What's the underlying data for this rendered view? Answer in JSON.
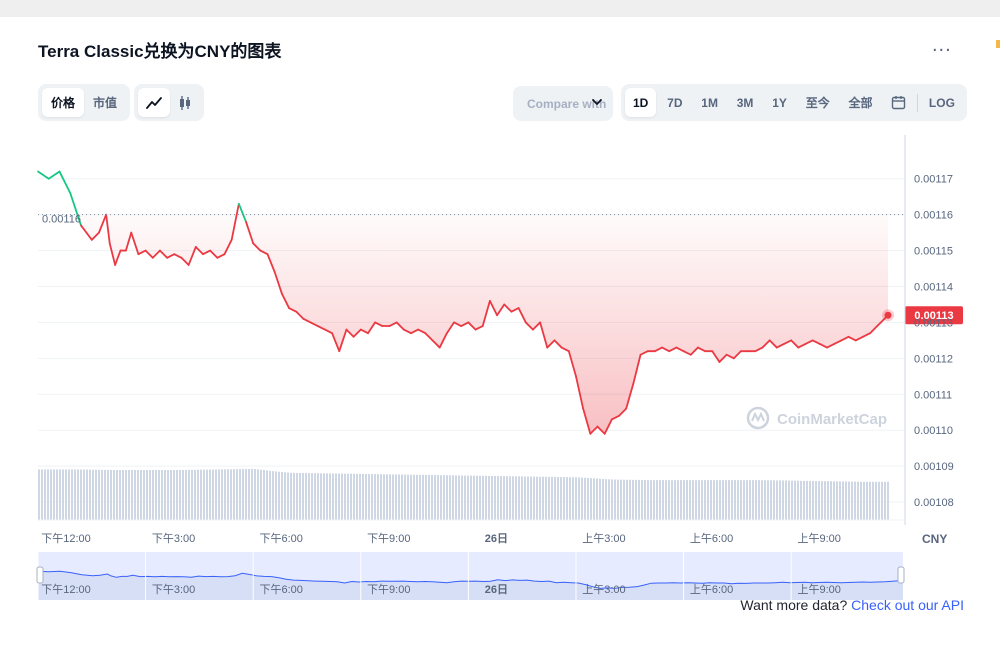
{
  "title": "Terra Classic兑换为CNY的图表",
  "more_label": "...",
  "toggle_metric": [
    {
      "label": "价格",
      "active": true
    },
    {
      "label": "市值",
      "active": false
    }
  ],
  "chart_type_icons": [
    {
      "icon": "line-chart-icon",
      "active": true
    },
    {
      "icon": "candlestick-icon",
      "active": false
    }
  ],
  "compare_label": "Compare with",
  "ranges": [
    {
      "label": "1D",
      "active": true
    },
    {
      "label": "7D",
      "active": false
    },
    {
      "label": "1M",
      "active": false
    },
    {
      "label": "3M",
      "active": false
    },
    {
      "label": "1Y",
      "active": false
    },
    {
      "label": "至今",
      "active": false
    },
    {
      "label": "全部",
      "active": false
    }
  ],
  "calendar_icon": "calendar-icon",
  "log_label": "LOG",
  "watermark": "CoinMarketCap",
  "footer": {
    "text": "Want more data?",
    "link": "Check out our API"
  },
  "colors": {
    "up": "#16c784",
    "down": "#ea3943",
    "volume": "#cfd6e4",
    "nav_fill": "#e6ebff",
    "nav_line": "#3861fb",
    "accent": "#3861fb"
  },
  "chart_data": {
    "type": "line",
    "currency": "CNY",
    "open_price_label": "0.00116",
    "open_price": 0.00116,
    "current_price_label": "0.00113",
    "current_price": 0.001132,
    "ylim": [
      0.001075,
      0.001178
    ],
    "y_ticks": [
      "0.00117",
      "0.00116",
      "0.00115",
      "0.00114",
      "0.00113",
      "0.00112",
      "0.00111",
      "0.00110",
      "0.00109",
      "0.00108"
    ],
    "y_tick_values": [
      0.00117,
      0.00116,
      0.00115,
      0.00114,
      0.00113,
      0.00112,
      0.00111,
      0.0011,
      0.00109,
      0.00108
    ],
    "x_ticks": [
      "下午12:00",
      "下午3:00",
      "下午6:00",
      "下午9:00",
      "26日",
      "上午3:00",
      "上午6:00",
      "上午9:00"
    ],
    "x_tick_hours": [
      0,
      3,
      6,
      9,
      12,
      15,
      18,
      21
    ],
    "x_axis_unit": "CNY",
    "x_hours_range": [
      0,
      23.7
    ],
    "series": [
      {
        "x": [
          0,
          0.3,
          0.6,
          0.9,
          1.2,
          1.35,
          1.5,
          1.7,
          1.9,
          2.0,
          2.15,
          2.3,
          2.45,
          2.6,
          2.8,
          3.0,
          3.2,
          3.4,
          3.6,
          3.8,
          4.0,
          4.2,
          4.4,
          4.6,
          4.8,
          5.0,
          5.2,
          5.4,
          5.6,
          5.8,
          6.0,
          6.2,
          6.4,
          6.6,
          6.8,
          7.0,
          7.2,
          7.4,
          7.6,
          7.8,
          8.0,
          8.2,
          8.4,
          8.6,
          8.8,
          9.0,
          9.2,
          9.4,
          9.6,
          9.8,
          10.0,
          10.2,
          10.4,
          10.6,
          10.8,
          11.0,
          11.2,
          11.4,
          11.6,
          11.8,
          12.0,
          12.2,
          12.4,
          12.6,
          12.8,
          13.0,
          13.2,
          13.4,
          13.6,
          13.8,
          14.0,
          14.2,
          14.4,
          14.6,
          14.8,
          15.0,
          15.2,
          15.4,
          15.6,
          15.8,
          16.0,
          16.2,
          16.4,
          16.6,
          16.8,
          17.0,
          17.2,
          17.4,
          17.6,
          17.8,
          18.0,
          18.2,
          18.4,
          18.6,
          18.8,
          19.0,
          19.2,
          19.4,
          19.6,
          19.8,
          20.0,
          20.2,
          20.4,
          20.6,
          20.8,
          21.0,
          21.2,
          21.4,
          21.6,
          21.8,
          22.0,
          22.2,
          22.4,
          22.6,
          22.8,
          23.0,
          23.2,
          23.4,
          23.6,
          23.7
        ],
        "y": [
          0.001172,
          0.00117,
          0.001172,
          0.001166,
          0.001157,
          0.001155,
          0.001153,
          0.001155,
          0.00116,
          0.001152,
          0.001146,
          0.00115,
          0.00115,
          0.001155,
          0.001149,
          0.00115,
          0.001148,
          0.00115,
          0.001148,
          0.001149,
          0.001148,
          0.001146,
          0.001151,
          0.001149,
          0.00115,
          0.001148,
          0.001149,
          0.001153,
          0.001163,
          0.001158,
          0.001152,
          0.00115,
          0.001149,
          0.001144,
          0.001138,
          0.001134,
          0.001133,
          0.001131,
          0.00113,
          0.001129,
          0.001128,
          0.001127,
          0.001122,
          0.001128,
          0.001126,
          0.001128,
          0.001127,
          0.00113,
          0.001129,
          0.001129,
          0.00113,
          0.001128,
          0.001127,
          0.001128,
          0.001127,
          0.001125,
          0.001123,
          0.001127,
          0.00113,
          0.001129,
          0.00113,
          0.001128,
          0.001129,
          0.001136,
          0.001132,
          0.001135,
          0.001133,
          0.001134,
          0.00113,
          0.001128,
          0.00113,
          0.001123,
          0.001125,
          0.001123,
          0.001122,
          0.001115,
          0.001106,
          0.001099,
          0.001101,
          0.001099,
          0.001103,
          0.001104,
          0.001106,
          0.001113,
          0.001121,
          0.001122,
          0.001122,
          0.001123,
          0.001122,
          0.001123,
          0.001122,
          0.001121,
          0.001123,
          0.001122,
          0.001122,
          0.001119,
          0.001121,
          0.00112,
          0.001122,
          0.001122,
          0.001122,
          0.001123,
          0.001125,
          0.001123,
          0.001124,
          0.001125,
          0.001123,
          0.001124,
          0.001125,
          0.001124,
          0.001123,
          0.001124,
          0.001125,
          0.001126,
          0.001125,
          0.001126,
          0.001127,
          0.001129,
          0.001131,
          0.001132
        ]
      }
    ],
    "volume": {
      "x": [
        0,
        1,
        2,
        3,
        4,
        5,
        6,
        6.5,
        7,
        8,
        9,
        10,
        11,
        12,
        13,
        14,
        15,
        16,
        17,
        18,
        19,
        20,
        21,
        22,
        23,
        23.7
      ],
      "relative": [
        0.9,
        0.9,
        0.89,
        0.89,
        0.89,
        0.9,
        0.91,
        0.87,
        0.84,
        0.83,
        0.82,
        0.81,
        0.8,
        0.79,
        0.78,
        0.77,
        0.76,
        0.72,
        0.71,
        0.71,
        0.71,
        0.71,
        0.7,
        0.69,
        0.68,
        0.68
      ]
    }
  }
}
